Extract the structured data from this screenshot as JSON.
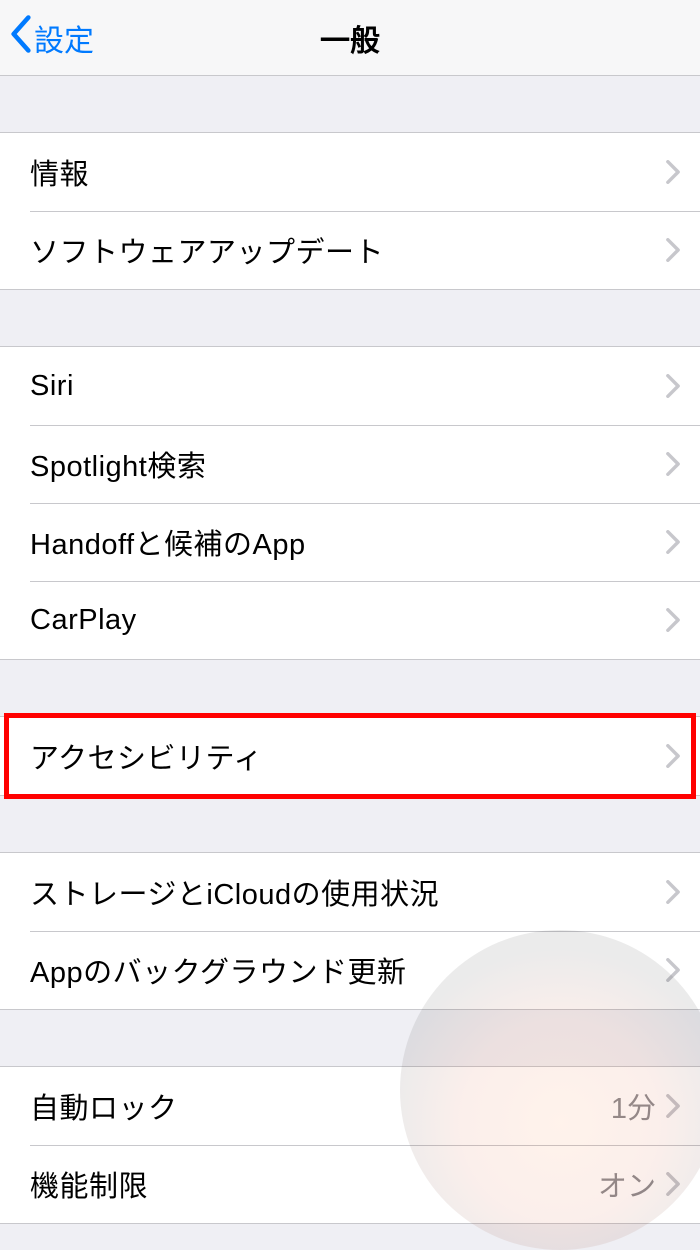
{
  "navbar": {
    "back_label": "設定",
    "title": "一般"
  },
  "groups": [
    {
      "rows": [
        {
          "label": "情報"
        },
        {
          "label": "ソフトウェアアップデート"
        }
      ]
    },
    {
      "rows": [
        {
          "label": "Siri"
        },
        {
          "label": "Spotlight検索"
        },
        {
          "label": "Handoffと候補のApp"
        },
        {
          "label": "CarPlay"
        }
      ]
    },
    {
      "highlighted": true,
      "rows": [
        {
          "label": "アクセシビリティ"
        }
      ]
    },
    {
      "rows": [
        {
          "label": "ストレージとiCloudの使用状況"
        },
        {
          "label": "Appのバックグラウンド更新"
        }
      ]
    },
    {
      "rows": [
        {
          "label": "自動ロック",
          "value": "1分"
        },
        {
          "label": "機能制限",
          "value": "オン"
        }
      ]
    }
  ]
}
